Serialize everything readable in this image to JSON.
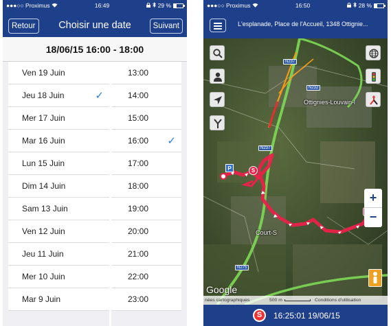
{
  "left_screen": {
    "status": {
      "carrier": "●●●○○ Proximus",
      "wifi": "wifi-icon",
      "time": "16:49",
      "battery": "29 %",
      "battery_level": 0.29
    },
    "nav": {
      "back_label": "Retour",
      "title": "Choisir une date",
      "next_label": "Suivant"
    },
    "selected_range": "18/06/15 16:00 - 18:00",
    "dates": [
      {
        "label": "Ven 19 Juin",
        "selected": false
      },
      {
        "label": "Jeu 18 Juin",
        "selected": true
      },
      {
        "label": "Mer 17 Juin",
        "selected": false
      },
      {
        "label": "Mar 16 Juin",
        "selected": false
      },
      {
        "label": "Lun 15 Juin",
        "selected": false
      },
      {
        "label": "Dim 14 Juin",
        "selected": false
      },
      {
        "label": "Sam 13 Juin",
        "selected": false
      },
      {
        "label": "Ven 12 Juin",
        "selected": false
      },
      {
        "label": "Jeu 11 Juin",
        "selected": false
      },
      {
        "label": "Mer 10 Juin",
        "selected": false
      },
      {
        "label": "Mar 9 Juin",
        "selected": false
      }
    ],
    "times": [
      {
        "label": "13:00",
        "selected": false
      },
      {
        "label": "14:00",
        "selected": false
      },
      {
        "label": "15:00",
        "selected": false
      },
      {
        "label": "16:00",
        "selected": true
      },
      {
        "label": "17:00",
        "selected": false
      },
      {
        "label": "18:00",
        "selected": false
      },
      {
        "label": "19:00",
        "selected": false
      },
      {
        "label": "20:00",
        "selected": false
      },
      {
        "label": "21:00",
        "selected": false
      },
      {
        "label": "22:00",
        "selected": false
      },
      {
        "label": "23:00",
        "selected": false
      }
    ],
    "check_glyph": "✓"
  },
  "right_screen": {
    "status": {
      "carrier": "●●●○○ Proximus",
      "wifi": "wifi-icon",
      "time": "16:50",
      "battery": "28 %",
      "battery_level": 0.28
    },
    "address": "L'esplanade, Place de l'Accueil, 1348 Ottignie...",
    "map": {
      "labels": {
        "town1": "Ottignies-Louvain-l",
        "town2": "Court-S"
      },
      "roads": {
        "n237": "N237",
        "n232": "N232",
        "n237b": "N237",
        "n275": "N275"
      },
      "markers": {
        "parking": "P",
        "start": "S",
        "end": "S"
      },
      "tools": [
        "search-icon",
        "person-icon",
        "locate-icon",
        "route-split-icon"
      ],
      "layer_tools": [
        "globe-icon",
        "traffic-light-icon",
        "directions-icon"
      ],
      "zoom_in": "+",
      "zoom_out": "−",
      "google": "Google",
      "attribution": {
        "data": "nées cartographiques",
        "scale": "500 m",
        "terms": "Conditions d'utilisation"
      },
      "colors": {
        "track": "#e8224a",
        "highway": "#7ed957",
        "primary_road": "#f39c12"
      }
    },
    "bottom": {
      "badge": "S",
      "timestamp": "16:25:01 19/06/15"
    }
  }
}
